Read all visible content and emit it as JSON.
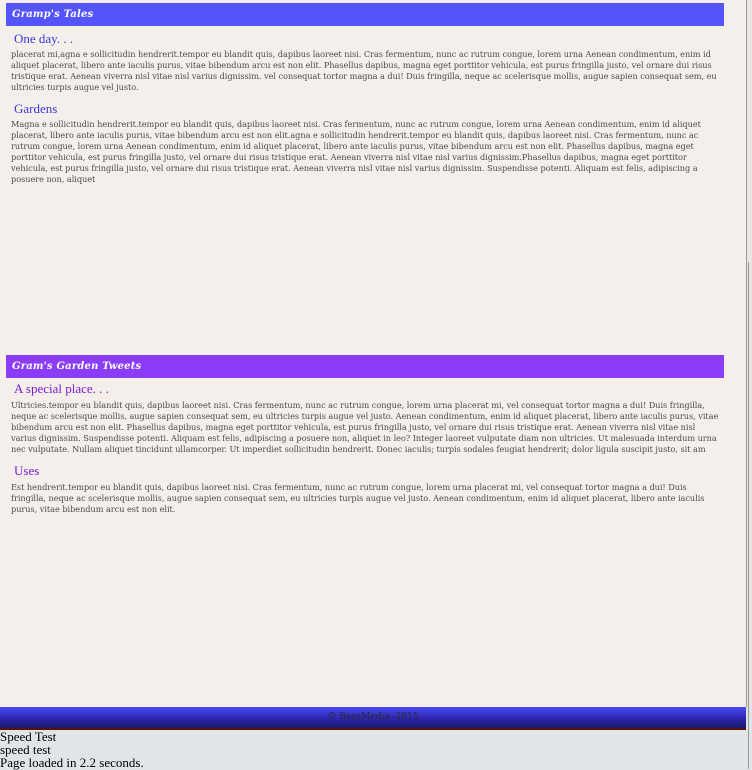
{
  "banners": {
    "top": "Gramp's Tales",
    "bottom": "Gram's Garden Tweets"
  },
  "sections": [
    {
      "heading": "One day. . .",
      "text": "placerat mi,agna e sollicitudin hendrerit.tempor eu blandit quis, dapibus laoreet nisi. Cras fermentum, nunc ac rutrum congue, lorem urna Aenean condimentum, enim id aliquet placerat, libero ante iaculis purus, vitae bibendum arcu est non elit. Phasellus dapibus, magna eget porttitor vehicula, est purus fringilla justo, vel ornare dui risus tristique erat. Aenean viverra nisl vitae nisl varius dignissim. vel consequat tortor magna a dui! Duis fringilla, neque ac scelerisque mollis, augue sapien consequat sem, eu ultricies turpis augue vel justo."
    },
    {
      "heading": "Gardens",
      "text": "Magna e sollicitudin hendrerit.tempor eu blandit quis, dapibus laoreet nisi. Cras fermentum, nunc ac rutrum congue, lorem urna Aenean condimentum, enim id aliquet placerat, libero ante iaculis purus, vitae bibendum arcu est non elit.agna e sollicitudin hendrerit.tempor eu blandit quis, dapibus laoreet nisi. Cras fermentum, nunc ac rutrum congue, lorem urna Aenean condimentum, enim id aliquet placerat, libero ante iaculis purus, vitae bibendum arcu est non elit. Phasellus dapibus, magna eget porttitor vehicula, est purus fringilla justo, vel ornare dui risus tristique erat. Aenean viverra nisl vitae nisl varius dignissim.Phasellus dapibus, magna eget porttitor vehicula, est purus fringilla justo, vel ornare dui risus tristique erat. Aenean viverra nisl vitae nisl varius dignissim. Suspendisse potenti. Aliquam est felis, adipiscing a posuere non, aliquet"
    },
    {
      "heading": "A special place. . .",
      "text": "Ultricies.tempor eu blandit quis, dapibus laoreet nisi. Cras fermentum, nunc ac rutrum congue, lorem urna placerat mi, vel consequat tortor magna a dui! Duis fringilla, neque ac scelerisque mollis, augue sapien consequat sem, eu ultricies turpis augue vel justo. Aenean condimentum, enim id aliquet placerat, libero ante iaculis purus, vitae bibendum arcu est non elit. Phasellus dapibus, magna eget porttitor vehicula, est purus fringilla justo, vel ornare dui risus tristique erat. Aenean viverra nisl vitae nisl varius dignissim. Suspendisse potenti. Aliquam est felis, adipiscing a posuere non, aliquet in leo? Integer laoreet vulputate diam non ultricies. Ut malesuada interdum urna nec vulputate. Nullam aliquet tincidunt ullamcorper. Ut imperdiet sollicitudin hendrerit. Donec iaculis; turpis sodales feugiat hendrerit; dolor ligula suscipit justo, sit am"
    },
    {
      "heading": "Uses",
      "text": "Est hendrerit.tempor eu blandit quis, dapibus laoreet nisi. Cras fermentum, nunc ac rutrum congue, lorem urna placerat mi, vel consequat tortor magna a dui! Duis fringilla, neque ac scelerisque mollis, augue sapien consequat sem, eu ultricies turpis augue vel justo. Aenean condimentum, enim id aliquet placerat, libero ante iaculis purus, vitae bibendum arcu est non elit."
    }
  ],
  "footer": {
    "copyright": "© BeezMedia -2015"
  },
  "speed": {
    "line1": "Speed Test",
    "line2": "speed test",
    "line3": "Page loaded in 2.2 seconds."
  },
  "colors": {
    "banner_top": "#5454fb",
    "banner_bottom": "#8a3cf7",
    "heading_blue": "#3a3ad6",
    "heading_purple": "#7a1ad0"
  }
}
